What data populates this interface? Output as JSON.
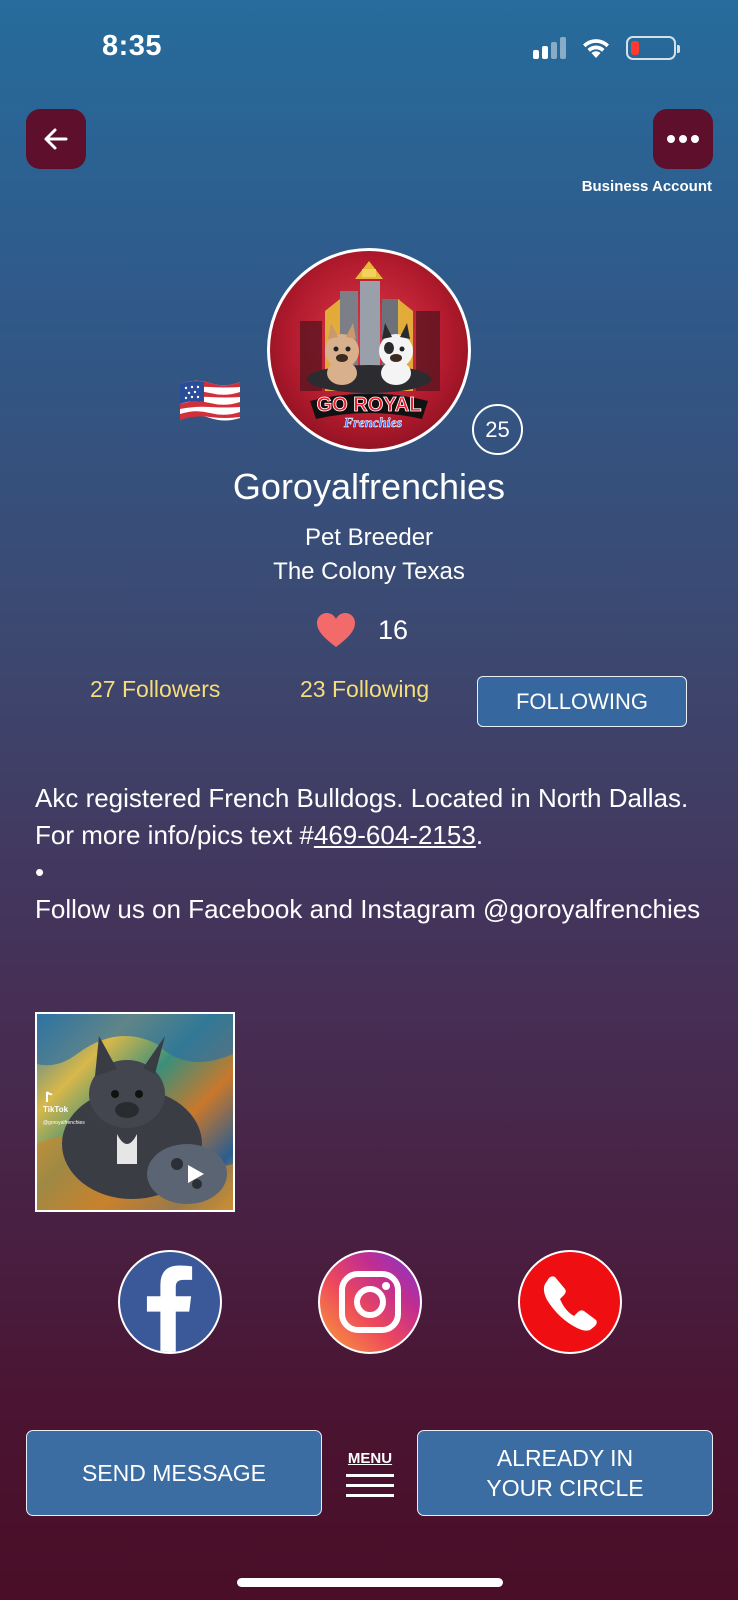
{
  "status_bar": {
    "time": "8:35",
    "battery_color": "#ff3b30"
  },
  "header": {
    "back_icon": "arrow-left-icon",
    "more_icon": "ellipsis-icon",
    "account_type": "Business Account"
  },
  "profile": {
    "username": "Goroyalfrenchies",
    "category": "Pet Breeder",
    "location": "The Colony Texas",
    "flag": "us-flag-icon",
    "badge_count": "25",
    "likes": "16",
    "avatar_text_1": "GO ROYAL",
    "avatar_text_2": "Frenchies"
  },
  "stats": {
    "followers": "27 Followers",
    "following": "23 Following",
    "follow_button": "FOLLOWING"
  },
  "bio": {
    "line1": "Akc registered French Bulldogs. Located in North Dallas. For more info/pics text #",
    "phone": "469-604-2153",
    "line1_end": ".",
    "bullet": "•",
    "line2": "Follow us on Facebook and Instagram @goroyalfrenchies"
  },
  "video": {
    "source_label": "TikTok",
    "handle": "@goroyalfrenchies"
  },
  "social": {
    "facebook_icon": "facebook-icon",
    "instagram_icon": "instagram-icon",
    "phone_icon": "phone-icon"
  },
  "bottom": {
    "send_message": "SEND MESSAGE",
    "menu_label": "MENU",
    "circle_line1": "ALREADY IN",
    "circle_line2": "YOUR CIRCLE"
  },
  "colors": {
    "accent_button": "#3b6ca2",
    "stat_text": "#f5dd7a",
    "header_button": "#5e0f2b",
    "heart": "#f26a6a"
  }
}
